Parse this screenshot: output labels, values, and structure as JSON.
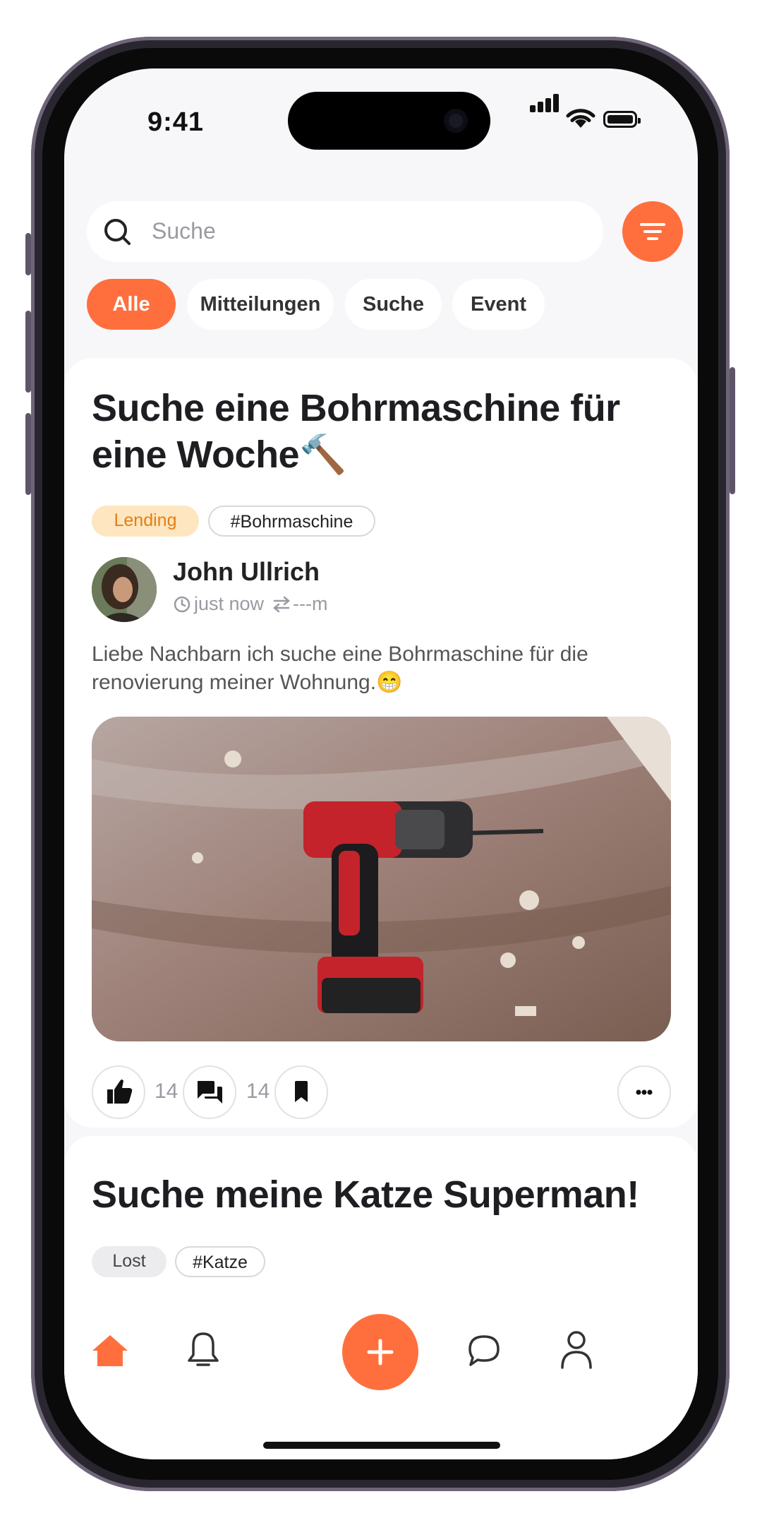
{
  "status_bar": {
    "time": "9:41"
  },
  "search": {
    "placeholder": "Suche"
  },
  "colors": {
    "accent": "#ff6f3d",
    "lending_bg": "#fde6c0",
    "lending_fg": "#e67e10"
  },
  "categories": [
    {
      "label": "Alle",
      "active": true
    },
    {
      "label": "Mitteilungen",
      "active": false
    },
    {
      "label": "Suche",
      "active": false
    },
    {
      "label": "Event",
      "active": false
    }
  ],
  "posts": [
    {
      "title_line1": "Suche eine Bohrmaschine für",
      "title_line2": "eine Woche🔨",
      "type_tag": "Lending",
      "hashtag": "#Bohrmaschine",
      "author": "John Ullrich",
      "time": "just now",
      "distance": "---m",
      "body": "Liebe Nachbarn ich suche eine Bohrmaschine für die renovierung meiner Wohnung.😁",
      "likes": "14",
      "comments": "14"
    },
    {
      "title": "Suche meine Katze Superman!",
      "type_tag": "Lost",
      "hashtag": "#Katze"
    }
  ],
  "icons": [
    "search-icon",
    "filter-icon",
    "clock-icon",
    "distance-icon",
    "thumbs-up-icon",
    "comment-icon",
    "bookmark-icon",
    "more-icon",
    "home-icon",
    "bell-icon",
    "plus-icon",
    "chat-icon",
    "profile-icon"
  ]
}
